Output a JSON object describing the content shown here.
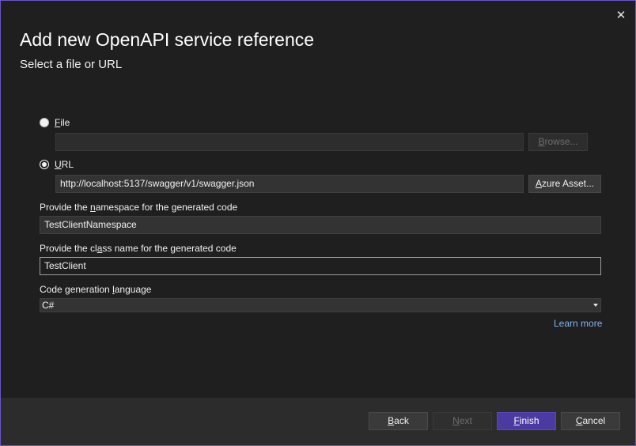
{
  "dialog": {
    "title": "Add new OpenAPI service reference",
    "subtitle": "Select a file or URL",
    "close_glyph": "✕"
  },
  "source": {
    "file": {
      "label_key": "F",
      "label_rest": "ile",
      "checked": false,
      "path_value": "",
      "browse_key": "B",
      "browse_rest": "rowse..."
    },
    "url": {
      "label_key": "U",
      "label_rest": "RL",
      "checked": true,
      "value": "http://localhost:5137/swagger/v1/swagger.json",
      "azure_key": "A",
      "azure_rest": "zure Asset..."
    }
  },
  "namespace": {
    "label_pre": "Provide the ",
    "label_key": "n",
    "label_post": "amespace for the generated code",
    "value": "TestClientNamespace"
  },
  "classname": {
    "label_pre": "Provide the cl",
    "label_key": "a",
    "label_post": "ss name for the generated code",
    "value": "TestClient"
  },
  "language": {
    "label_pre": "Code generation ",
    "label_key": "l",
    "label_post": "anguage",
    "selected": "C#"
  },
  "learn_more": "Learn more",
  "footer": {
    "back_key": "B",
    "back_rest": "ack",
    "next_key": "N",
    "next_rest": "ext",
    "finish_key": "F",
    "finish_rest": "inish",
    "cancel_key": "C",
    "cancel_rest": "ancel"
  },
  "icons": {
    "close": "close-icon",
    "dropdown": "chevron-down-icon"
  },
  "colors": {
    "accent": "#4b3aa1",
    "border": "#6b54c6",
    "link": "#80b4f0",
    "background": "#1f1f1f"
  }
}
